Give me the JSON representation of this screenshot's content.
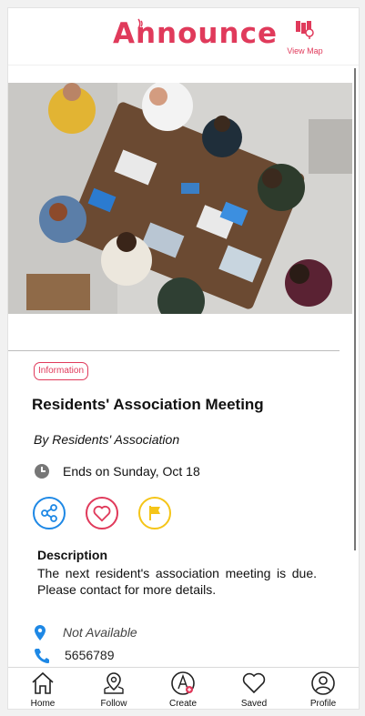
{
  "header": {
    "brand": "Announce",
    "map_label": "View Map",
    "accent": "#e03a5b"
  },
  "event": {
    "category": "Information",
    "title": "Residents' Association Meeting",
    "author": "By Residents' Association",
    "ends": "Ends on Sunday, Oct 18",
    "description_heading": "Description",
    "description": "The next resident's association meeting is due. Please contact for more details.",
    "location": "Not Available",
    "phone": "5656789"
  },
  "actions": [
    {
      "icon": "share-icon",
      "color": "#1e88e5"
    },
    {
      "icon": "heart-icon",
      "color": "#e03a5b"
    },
    {
      "icon": "flag-icon",
      "color": "#f5c518"
    }
  ],
  "nav": {
    "home": "Home",
    "follow": "Follow",
    "create": "Create",
    "saved": "Saved",
    "profile": "Profile"
  }
}
